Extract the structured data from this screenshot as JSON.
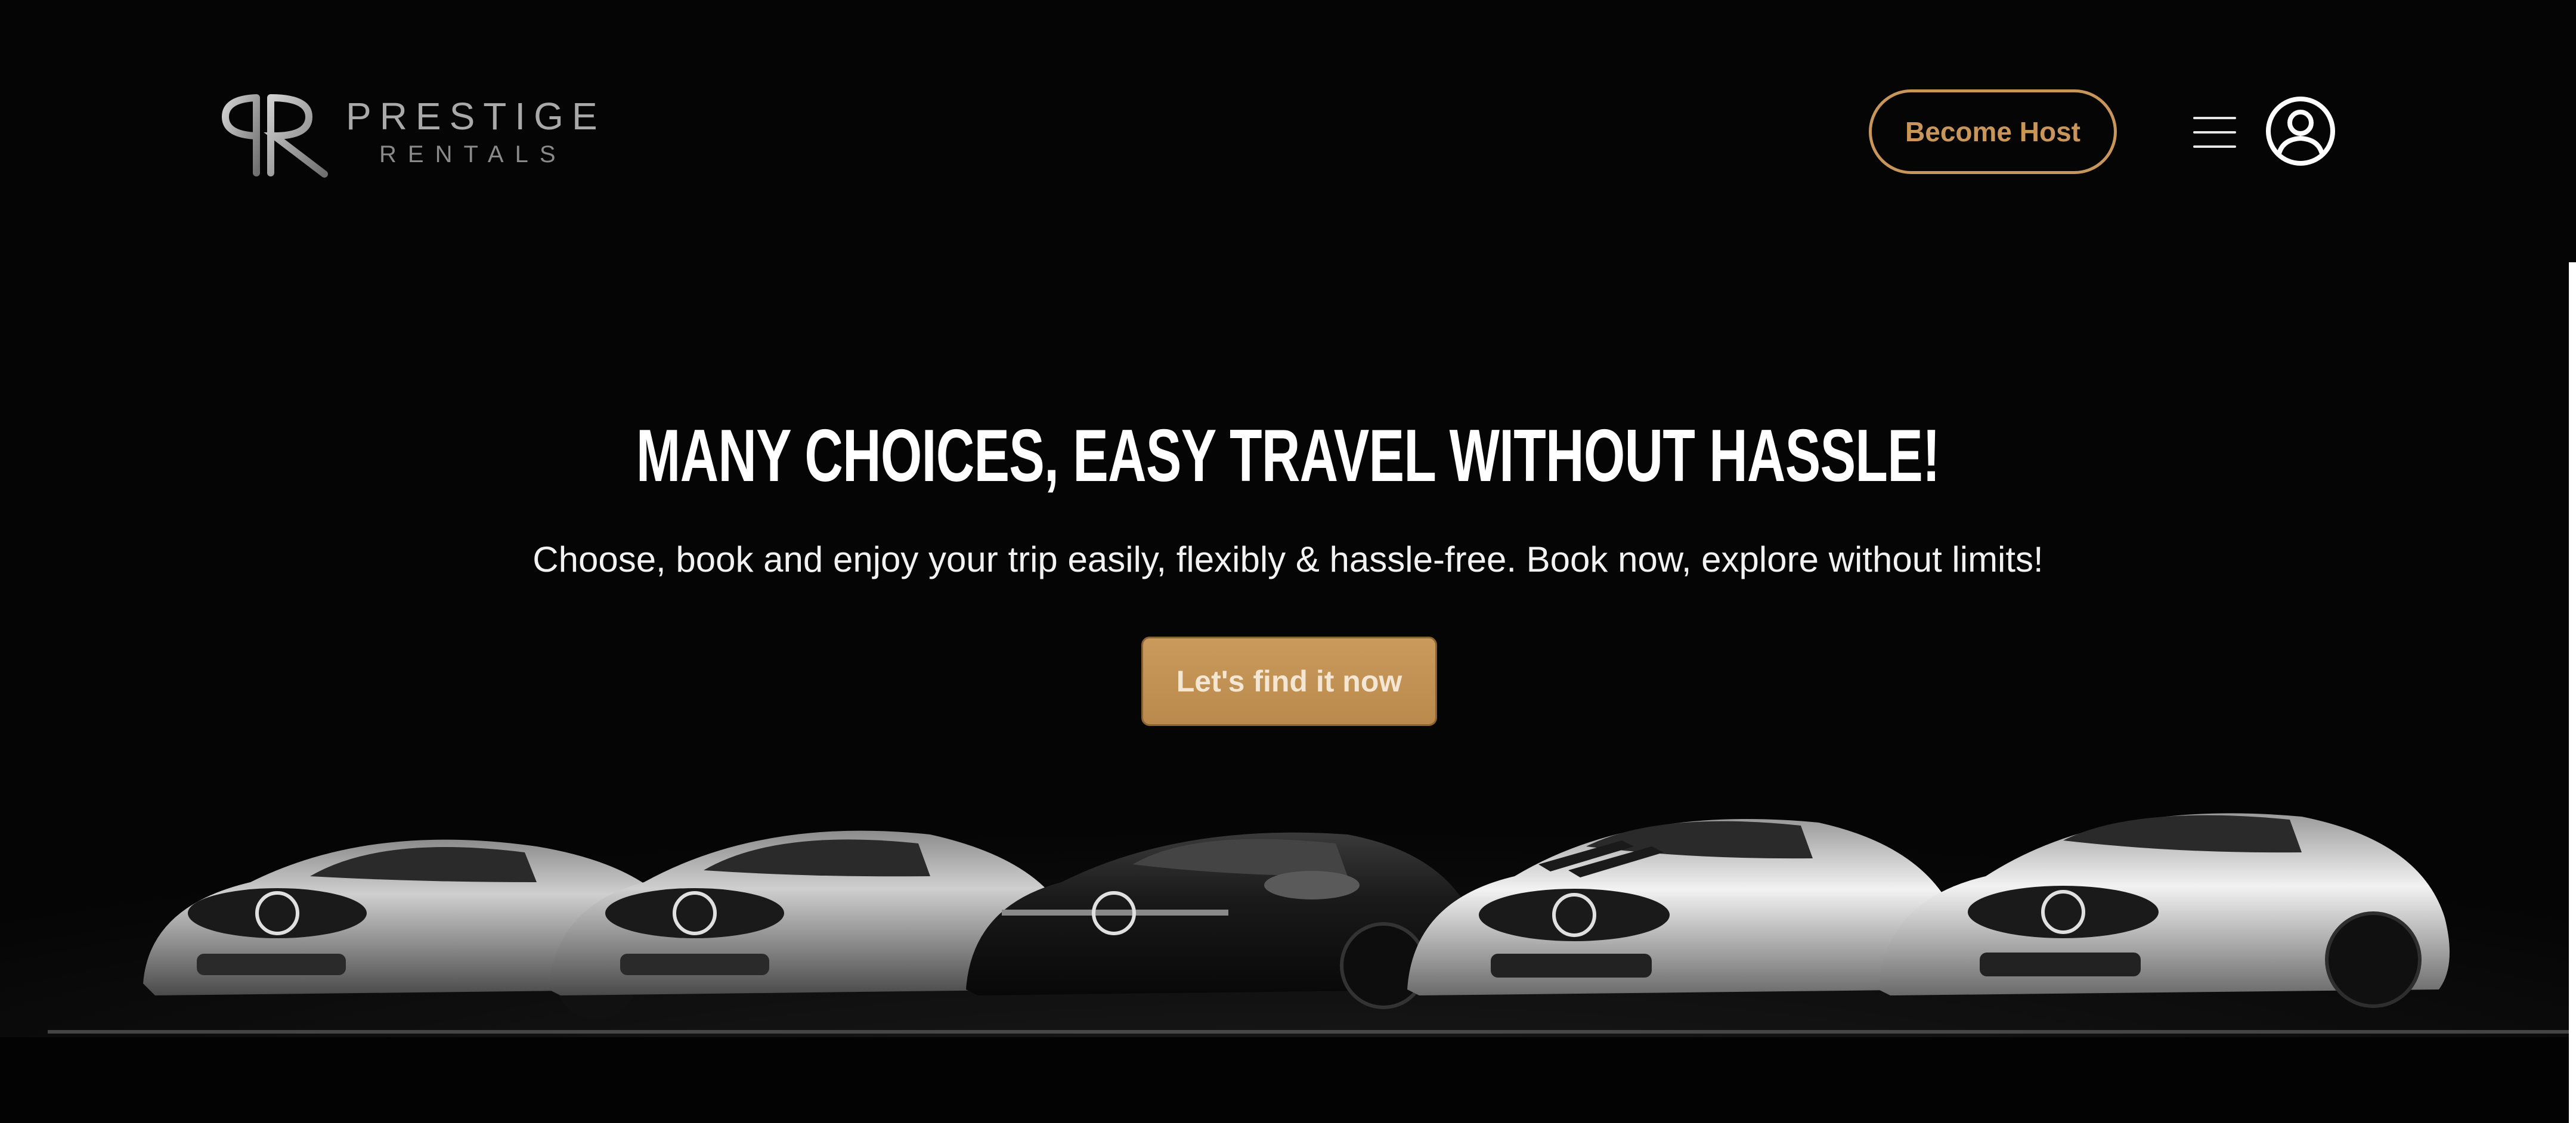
{
  "brand": {
    "name_line1": "PRESTIGE",
    "name_line2": "RENTALS"
  },
  "header": {
    "host_button": "Become Host",
    "menu_icon": "hamburger-menu-icon",
    "user_icon": "user-account-icon"
  },
  "hero": {
    "title": "MANY CHOICES, EASY TRAVEL WITHOUT HASSLE!",
    "subtitle": "Choose, book and enjoy your trip easily, flexibly & hassle-free. Book now, explore without limits!",
    "cta_button": "Let's find it now"
  },
  "colors": {
    "background": "#050505",
    "accent_gold": "#c8955a",
    "text": "#ffffff"
  }
}
